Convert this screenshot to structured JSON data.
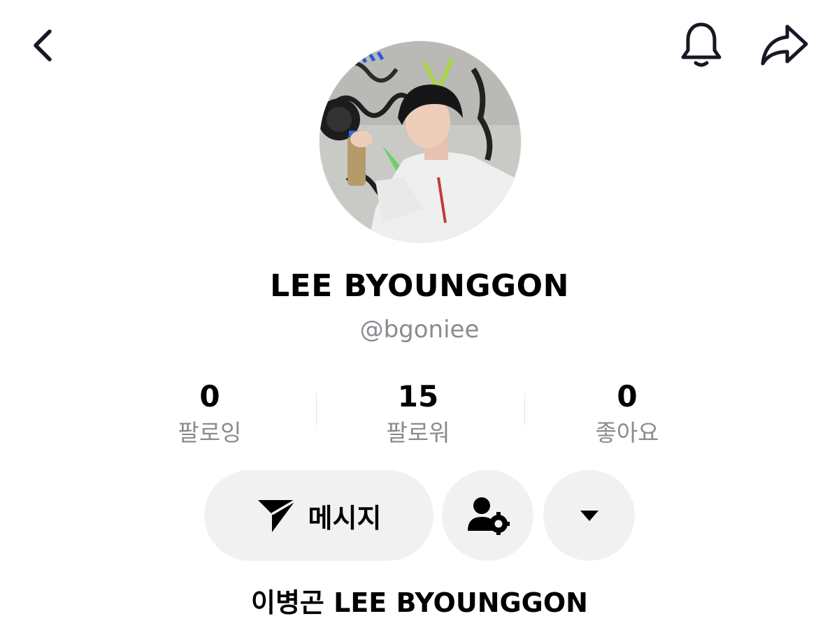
{
  "profile": {
    "display_name": "LEE BYOUNGGON",
    "username": "@bgoniee",
    "bio": "이병곤 LEE BYOUNGGON"
  },
  "stats": [
    {
      "value": "0",
      "label": "팔로잉"
    },
    {
      "value": "15",
      "label": "팔로워"
    },
    {
      "value": "0",
      "label": "좋아요"
    }
  ],
  "actions": {
    "message_label": "메시지"
  },
  "icons": {
    "back": "back-arrow-icon",
    "bell": "bell-icon",
    "share": "share-icon",
    "send": "send-icon",
    "friend_settings": "user-settings-icon",
    "more": "caret-down-icon"
  }
}
